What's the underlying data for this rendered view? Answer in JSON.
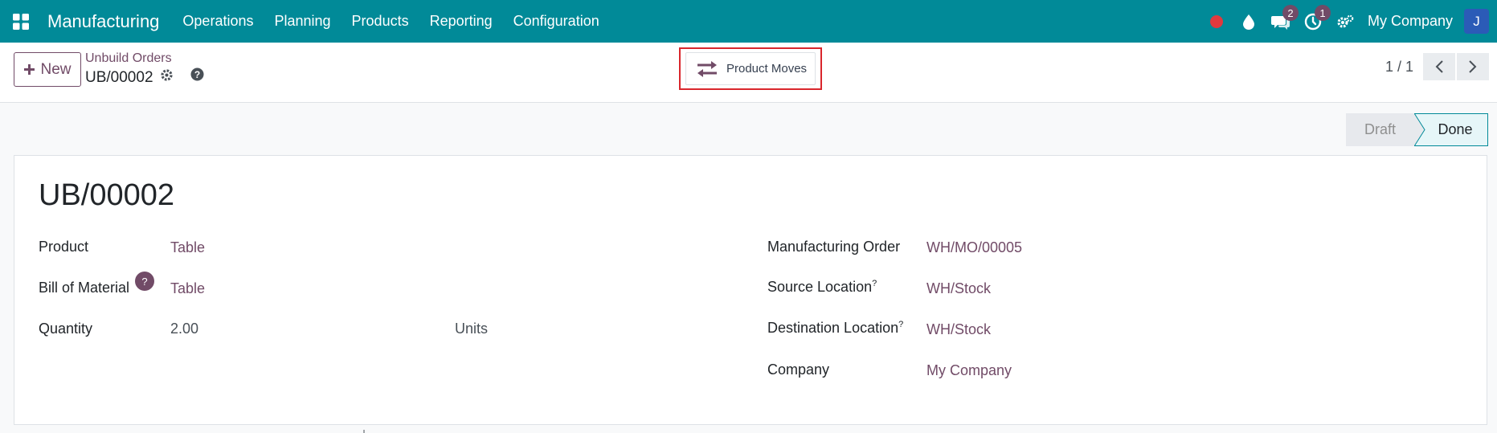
{
  "app": {
    "name": "Manufacturing",
    "menu": [
      "Operations",
      "Planning",
      "Products",
      "Reporting",
      "Configuration"
    ]
  },
  "systray": {
    "messages_count": "2",
    "activities_count": "1",
    "company": "My Company",
    "avatar_initial": "J"
  },
  "control_panel": {
    "new_label": "New",
    "breadcrumb_parent": "Unbuild Orders",
    "breadcrumb_current": "UB/00002",
    "smart_button_label": "Product Moves",
    "pager_value": "1 / 1"
  },
  "statusbar": {
    "stages": [
      "Draft",
      "Done"
    ],
    "current": "Done"
  },
  "form": {
    "title": "UB/00002",
    "left": {
      "product_label": "Product",
      "product_value": "Table",
      "bom_label": "Bill of Material",
      "bom_value": "Table",
      "quantity_label": "Quantity",
      "quantity_value": "2.00",
      "uom_value": "Units"
    },
    "right": {
      "mo_label": "Manufacturing Order",
      "mo_value": "WH/MO/00005",
      "source_label": "Source Location",
      "source_value": "WH/Stock",
      "dest_label": "Destination Location",
      "dest_value": "WH/Stock",
      "company_label": "Company",
      "company_value": "My Company"
    },
    "help_mark": "?"
  },
  "colors": {
    "navbar": "#018a98",
    "primary": "#714b67",
    "highlight": "#d9262c"
  }
}
